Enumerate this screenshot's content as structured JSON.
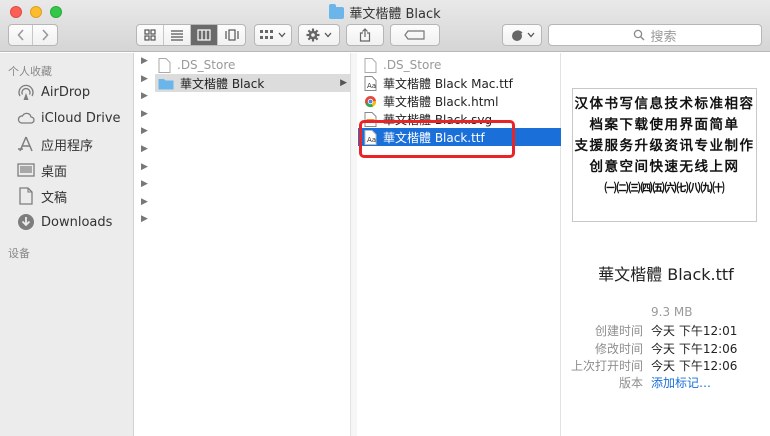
{
  "window": {
    "title": "華文楷體 Black"
  },
  "toolbar": {
    "back_icon": "chevron-left",
    "forward_icon": "chevron-right",
    "view_modes": [
      "icon-view",
      "list-view",
      "column-view",
      "cover-flow"
    ],
    "active_view": "column-view",
    "search_placeholder": "搜索"
  },
  "sidebar": {
    "favorites_header": "个人收藏",
    "items": [
      {
        "label": "AirDrop",
        "icon": "airdrop-icon"
      },
      {
        "label": "iCloud Drive",
        "icon": "cloud-icon"
      },
      {
        "label": "应用程序",
        "icon": "applications-icon"
      },
      {
        "label": "桌面",
        "icon": "desktop-icon"
      },
      {
        "label": "文稿",
        "icon": "document-icon"
      },
      {
        "label": "Downloads",
        "icon": "downloads-icon"
      }
    ],
    "devices_header": "设备"
  },
  "column1": {
    "items": [
      {
        "name": ".DS_Store"
      },
      {
        "name": "華文楷體 Black"
      }
    ]
  },
  "column2": {
    "items": [
      {
        "name": ".DS_Store"
      },
      {
        "name": "華文楷體 Black Mac.ttf"
      },
      {
        "name": "華文楷體 Black.html"
      },
      {
        "name": "華文楷體 Black.svg"
      },
      {
        "name": "華文楷體 Black.ttf"
      }
    ]
  },
  "preview": {
    "sample_lines": [
      "汉体书写信息技术标准相容",
      "档案下载使用界面简单",
      "支援服务升级资讯专业制作",
      "创意空间快速无线上网",
      "㈠㈡㈢㈣㈤㈥㈦㈧㈨㈩"
    ],
    "file_name": "華文楷體 Black.ttf",
    "size": "9.3 MB",
    "created_label": "创建时间",
    "created_value": "今天 下午12:01",
    "modified_label": "修改时间",
    "modified_value": "今天 下午12:06",
    "opened_label": "上次打开时间",
    "opened_value": "今天 下午12:06",
    "version_label": "版本",
    "version_value": "添加标记…"
  },
  "colors": {
    "selection_blue": "#1a6fd9",
    "highlight_red": "#e92326"
  }
}
